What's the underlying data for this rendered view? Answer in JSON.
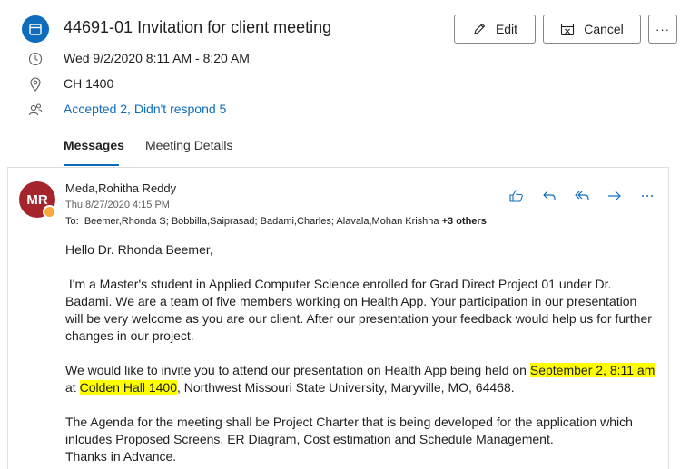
{
  "event": {
    "title": "44691-01 Invitation for client meeting",
    "time": "Wed 9/2/2020 8:11 AM - 8:20 AM",
    "location": "CH 1400",
    "attendance": "Accepted 2, Didn't respond 5"
  },
  "toolbar": {
    "edit_label": "Edit",
    "cancel_label": "Cancel",
    "more_label": "···"
  },
  "tabs": {
    "messages": "Messages",
    "meeting_details": "Meeting Details"
  },
  "message": {
    "avatar_initials": "MR",
    "sender": "Meda,Rohitha Reddy",
    "date": "Thu 8/27/2020 4:15 PM",
    "to_label": "To:",
    "recipients": "Beemer,Rhonda S; Bobbilla,Saiprasad; Badami,Charles; Alavala,Mohan Krishna",
    "recipients_more": "+3 others",
    "body": {
      "greeting": "Hello Dr. Rhonda Beemer,",
      "para1": " I'm a Master's student in Applied Computer Science enrolled for Grad Direct Project 01 under Dr. Badami. We are a team of five members working on Health App. Your participation in our presentation will be very welcome as you are our client. After our presentation your feedback would help us for further changes in our project.",
      "para2_a": "We would like to invite you to attend our presentation on Health App being held on ",
      "para2_hl1": "September 2, 8:11 am",
      "para2_b": " at ",
      "para2_hl2": "Colden Hall 1400",
      "para2_c": ", Northwest Missouri State University, Maryville, MO, 64468.",
      "para3": "The Agenda for the meeting shall be Project Charter that is being developed for the application which inlcudes Proposed Screens, ER Diagram, Cost estimation and Schedule Management.",
      "para4": "Thanks in Advance."
    }
  },
  "colors": {
    "accent": "#0f6cbd",
    "avatar_bg": "#a4262c",
    "presence": "#f8a83c",
    "highlight": "#ffff00"
  },
  "icons": [
    "calendar-icon",
    "clock-icon",
    "location-icon",
    "people-icon",
    "edit-icon",
    "cancel-calendar-icon",
    "more-icon",
    "like-icon",
    "reply-icon",
    "reply-all-icon",
    "forward-icon",
    "more-actions-icon"
  ]
}
